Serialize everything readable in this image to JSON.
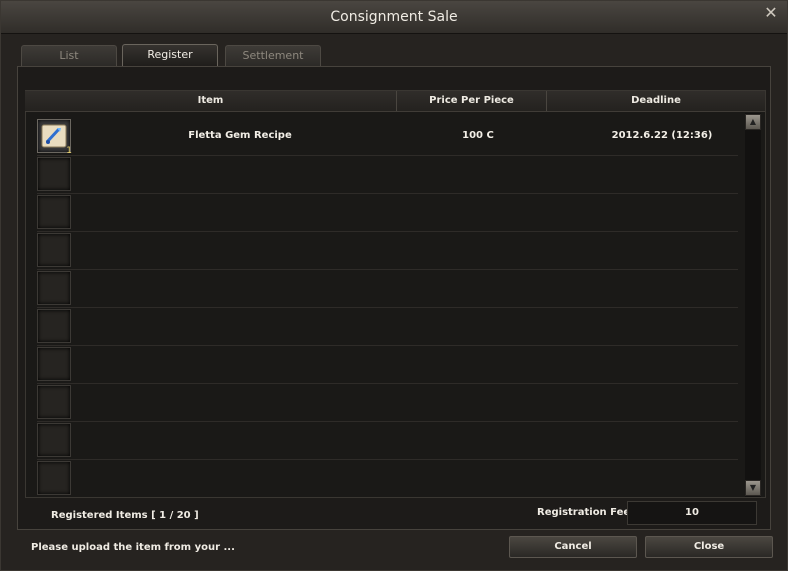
{
  "window": {
    "title": "Consignment Sale",
    "close_glyph": "✕"
  },
  "tabs": [
    {
      "label": "List",
      "active": false
    },
    {
      "label": "Register",
      "active": true
    },
    {
      "label": "Settlement",
      "active": false
    }
  ],
  "table": {
    "headers": {
      "item": "Item",
      "price": "Price Per Piece",
      "deadline": "Deadline"
    },
    "rows": [
      {
        "item": "Fletta Gem Recipe",
        "price": "100 C",
        "deadline": "2012.6.22 (12:36)",
        "quantity": "1",
        "icon": "recipe-scroll-icon"
      }
    ],
    "empty_slot_count": 8
  },
  "footer": {
    "registered_items": "Registered Items [ 1 / 20 ]",
    "fee_label": "Registration Fee",
    "fee_value": "10",
    "status_text": "Please upload the item from your ..."
  },
  "buttons": {
    "cancel": "Cancel",
    "close": "Close"
  }
}
